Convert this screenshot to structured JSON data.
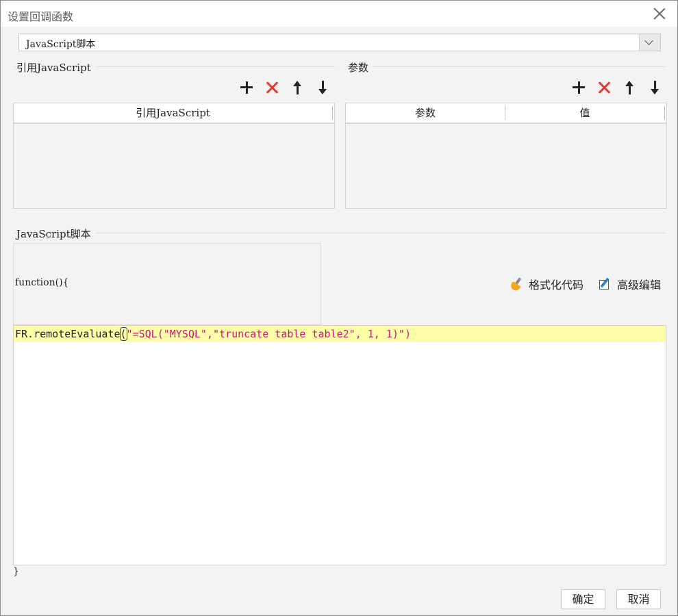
{
  "dialog": {
    "title": "设置回调函数"
  },
  "script_type": {
    "selected": "JavaScript脚本"
  },
  "ref_section": {
    "title": "引用JavaScript",
    "column": "引用JavaScript"
  },
  "param_section": {
    "title": "参数",
    "columns": [
      "参数",
      "值"
    ]
  },
  "script_section": {
    "title": "JavaScript脚本",
    "func_header": "function(){",
    "format_label": "格式化代码",
    "advanced_label": "高级编辑",
    "code": {
      "prefix": "FR.remoteEvaluate",
      "paren": "(",
      "string": "\"=SQL(\"MYSQL\",\"truncate table table2\", 1, 1)\")"
    },
    "closing": "}"
  },
  "footer": {
    "ok": "确定",
    "cancel": "取消"
  },
  "colors": {
    "highlight": "#ffffaa",
    "string": "#d2107e",
    "delete": "#e63b2e"
  }
}
